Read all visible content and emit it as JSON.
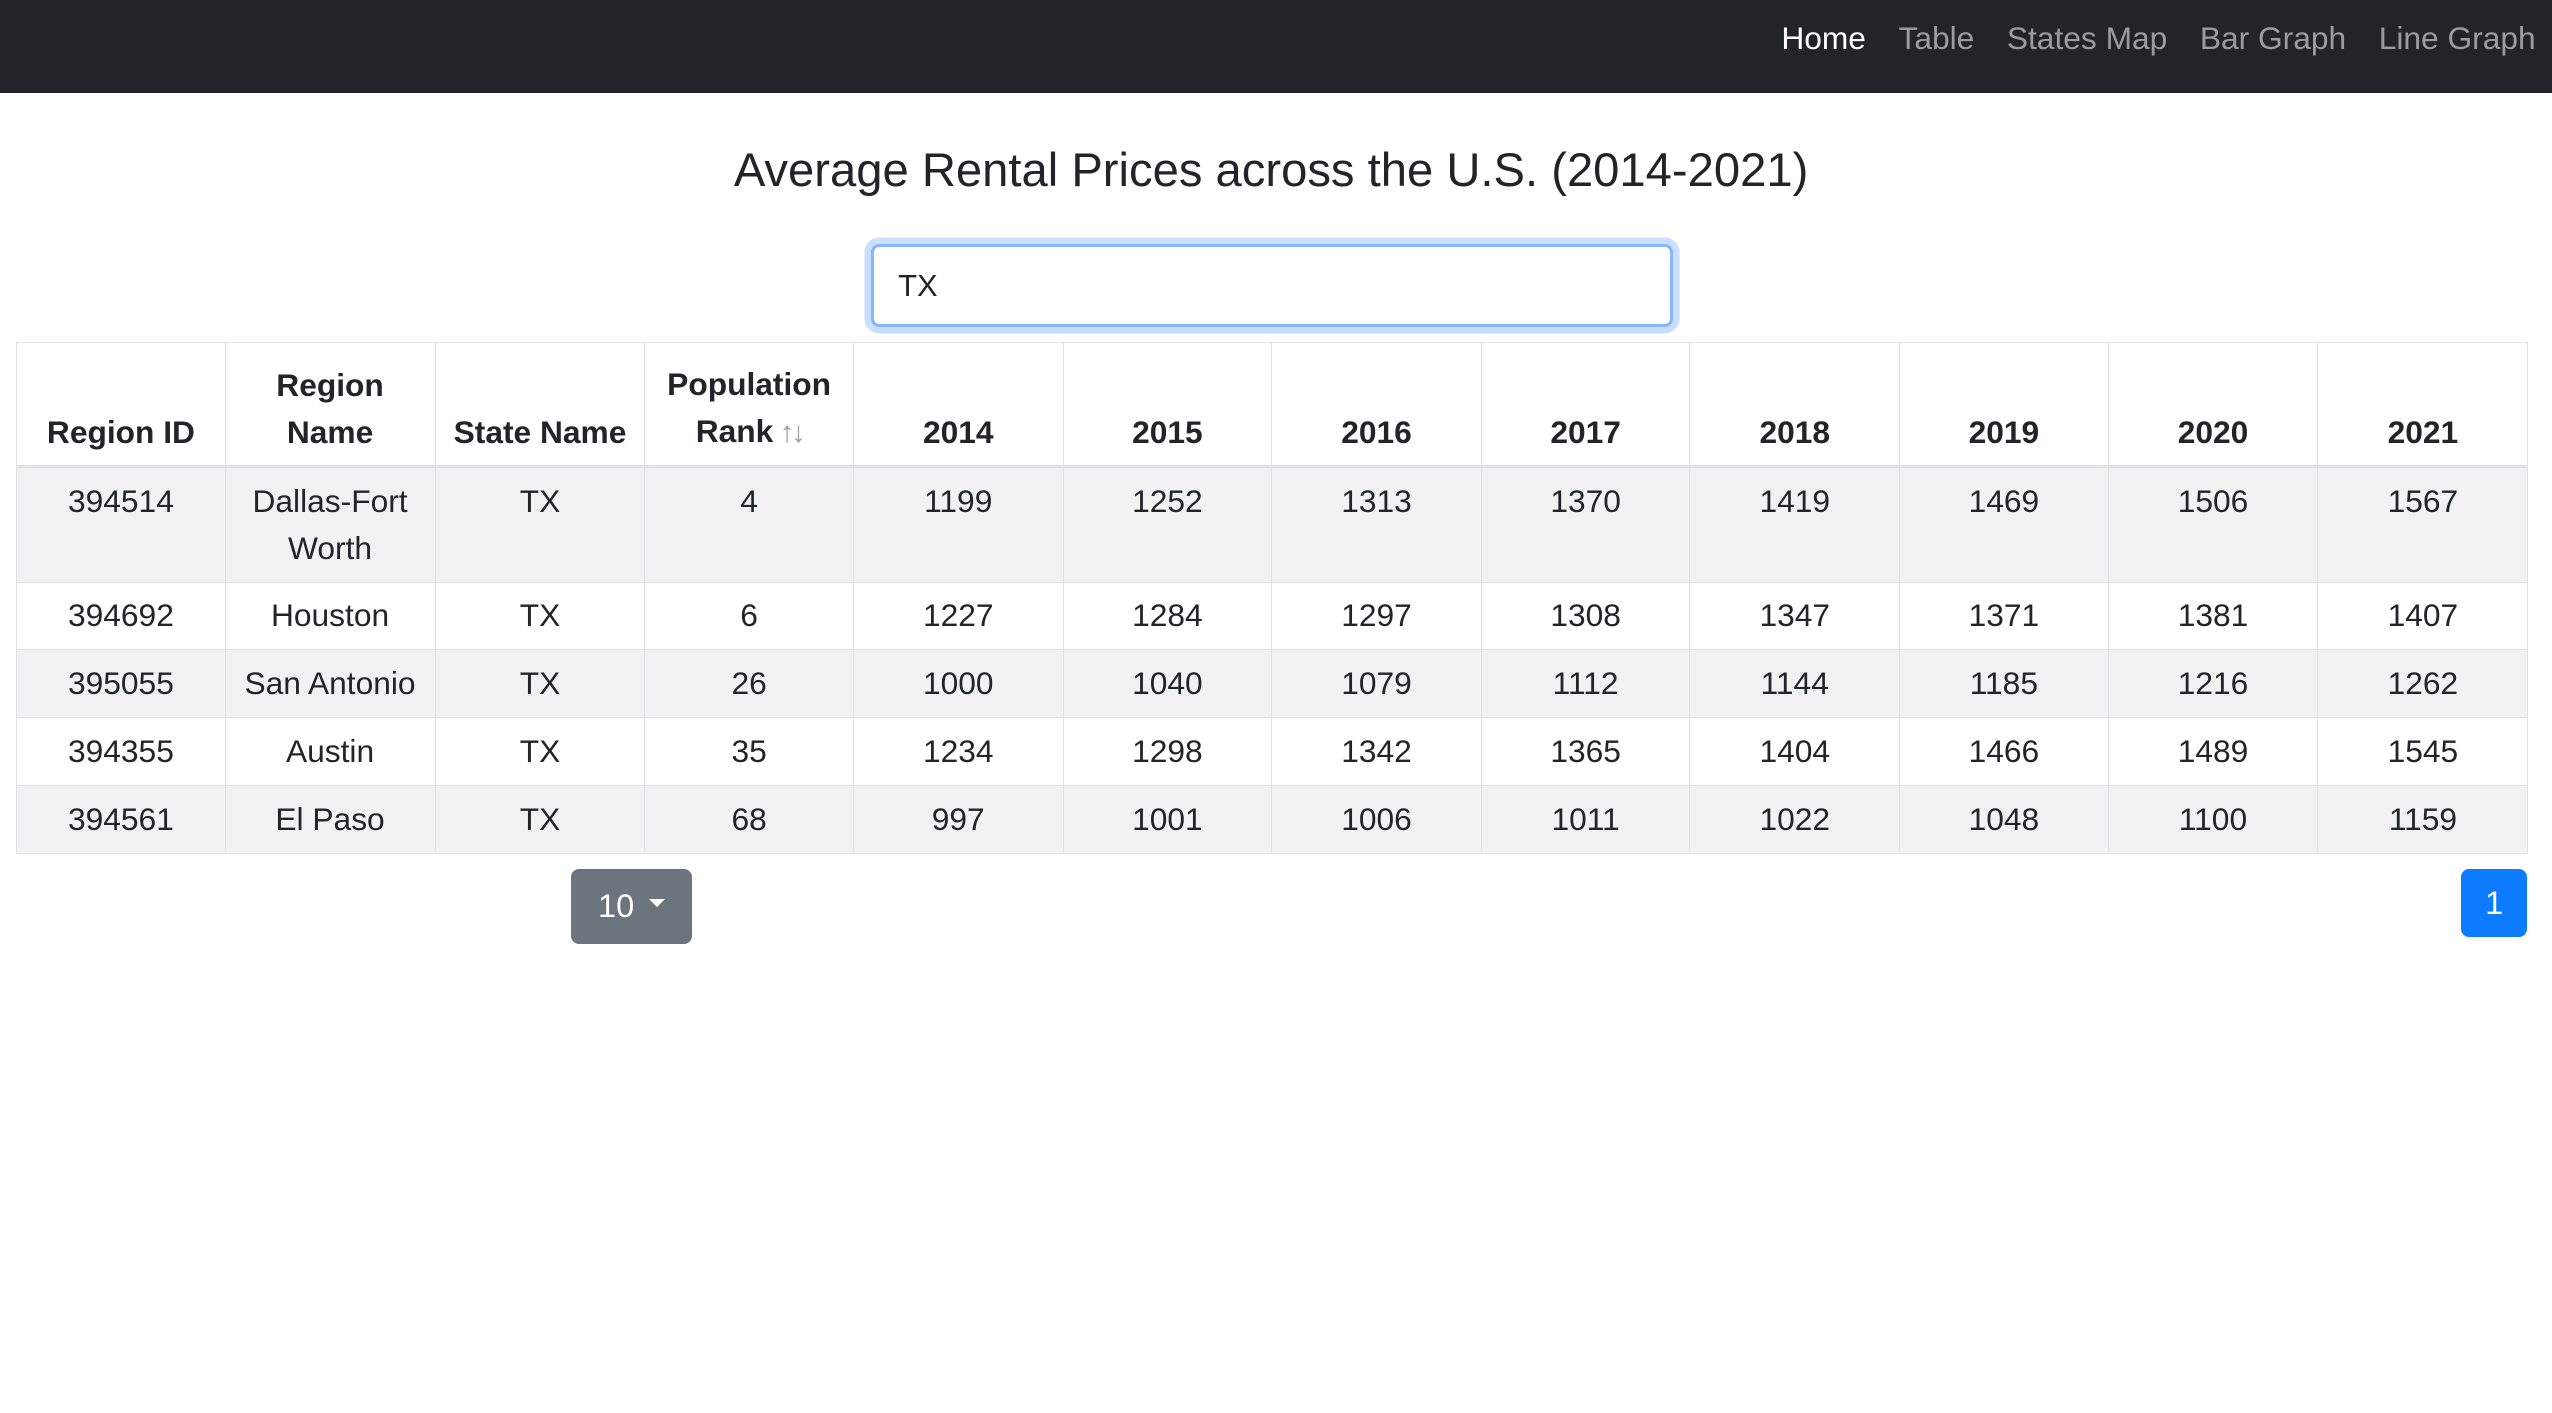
{
  "nav": {
    "items": [
      {
        "label": "Home",
        "active": true
      },
      {
        "label": "Table",
        "active": false
      },
      {
        "label": "States Map",
        "active": false
      },
      {
        "label": "Bar Graph",
        "active": false
      },
      {
        "label": "Line Graph",
        "active": false
      }
    ]
  },
  "page": {
    "title": "Average Rental Prices across the U.S. (2014-2021)"
  },
  "search": {
    "value": "TX"
  },
  "table": {
    "headers": [
      {
        "label": "Region ID"
      },
      {
        "label": "Region Name"
      },
      {
        "label": "State Name"
      },
      {
        "label": "Population Rank",
        "sortable": true,
        "sort_icons": "↑↓"
      },
      {
        "label": "2014"
      },
      {
        "label": "2015"
      },
      {
        "label": "2016"
      },
      {
        "label": "2017"
      },
      {
        "label": "2018"
      },
      {
        "label": "2019"
      },
      {
        "label": "2020"
      },
      {
        "label": "2021"
      }
    ],
    "rows": [
      [
        "394514",
        "Dallas-Fort Worth",
        "TX",
        "4",
        "1199",
        "1252",
        "1313",
        "1370",
        "1419",
        "1469",
        "1506",
        "1567"
      ],
      [
        "394692",
        "Houston",
        "TX",
        "6",
        "1227",
        "1284",
        "1297",
        "1308",
        "1347",
        "1371",
        "1381",
        "1407"
      ],
      [
        "395055",
        "San Antonio",
        "TX",
        "26",
        "1000",
        "1040",
        "1079",
        "1112",
        "1144",
        "1185",
        "1216",
        "1262"
      ],
      [
        "394355",
        "Austin",
        "TX",
        "35",
        "1234",
        "1298",
        "1342",
        "1365",
        "1404",
        "1466",
        "1489",
        "1545"
      ],
      [
        "394561",
        "El Paso",
        "TX",
        "68",
        "997",
        "1001",
        "1006",
        "1011",
        "1022",
        "1048",
        "1100",
        "1159"
      ]
    ]
  },
  "pagination": {
    "page_size": "10",
    "current_page": "1"
  },
  "colors": {
    "navbar_bg": "#212529",
    "accent": "#0d7bff",
    "size_button_bg": "#6c757d",
    "stripe": "#f2f2f2"
  }
}
